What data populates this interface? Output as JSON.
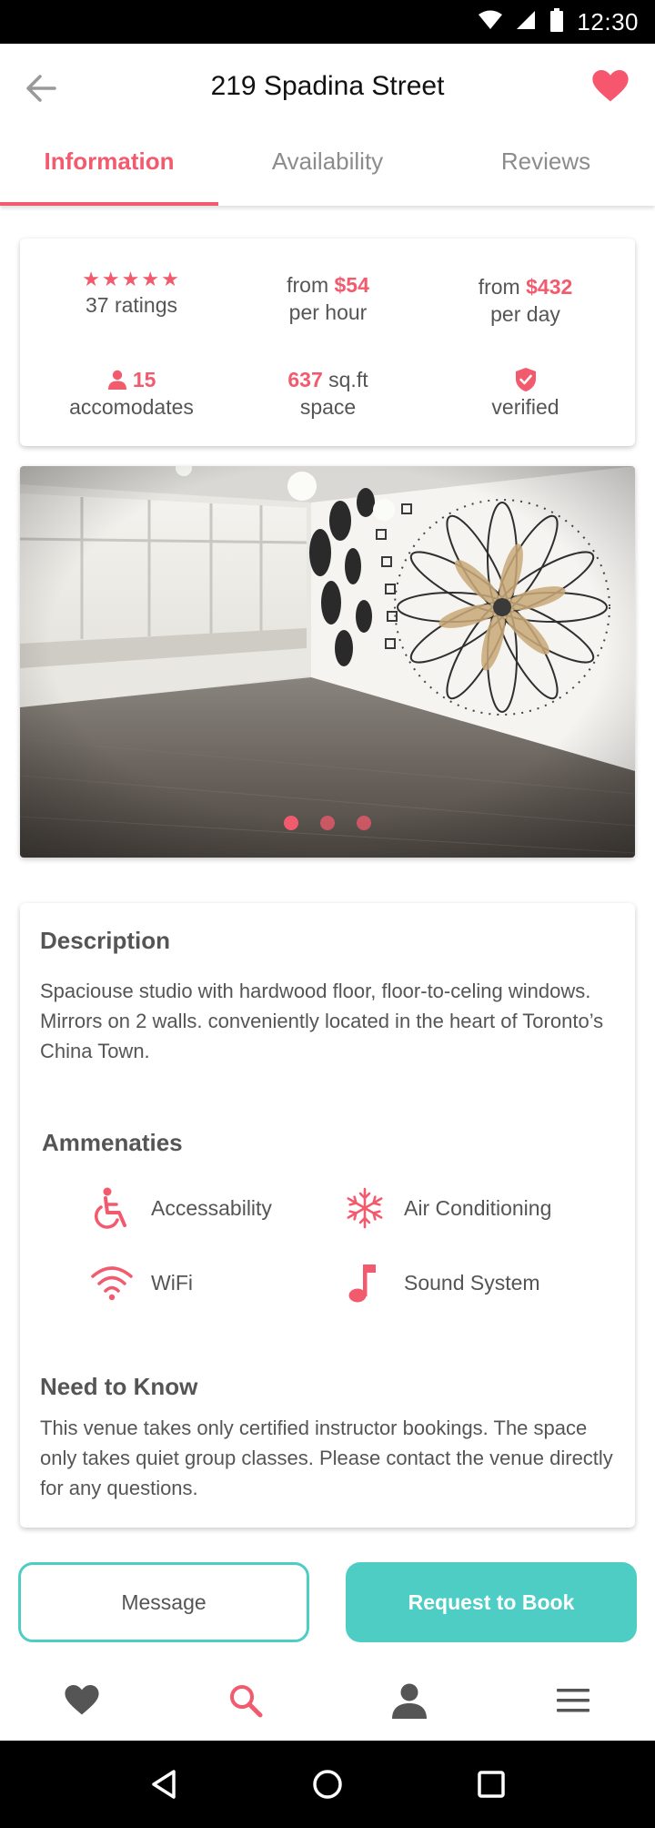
{
  "status_bar": {
    "time": "12:30"
  },
  "header": {
    "title": "219 Spadina Street"
  },
  "tabs": [
    {
      "label": "Information",
      "active": true
    },
    {
      "label": "Availability",
      "active": false
    },
    {
      "label": "Reviews",
      "active": false
    }
  ],
  "stats": {
    "rating_stars": "★★★★★",
    "ratings": "37 ratings",
    "hourly_prefix": "from",
    "hourly_price": "$54",
    "hourly_unit": "per hour",
    "daily_prefix": "from",
    "daily_price": "$432",
    "daily_unit": "per day",
    "capacity": "15",
    "capacity_label": "accomodates",
    "area_value": "637",
    "area_unit": "sq.ft",
    "area_label": "space",
    "verified_label": "verified"
  },
  "carousel": {
    "slides": 3,
    "active_index": 0
  },
  "description": {
    "title": "Description",
    "text": "Spaciouse studio with hardwood floor, floor-to-celing windows. Mirrors on 2 walls. conveniently located in the heart of Toronto’s China Town."
  },
  "amenities": {
    "title": "Ammenaties",
    "items": [
      {
        "label": "Accessability",
        "icon": "wheelchair-icon"
      },
      {
        "label": "Air Conditioning",
        "icon": "snowflake-icon"
      },
      {
        "label": "WiFi",
        "icon": "wifi-icon"
      },
      {
        "label": "Sound System",
        "icon": "music-note-icon"
      }
    ]
  },
  "need_to_know": {
    "title": "Need to Know",
    "text": "This venue takes only certified instructor bookings. The space only takes quiet group classes. Please contact the venue directly for any questions."
  },
  "actions": {
    "message_label": "Message",
    "book_label": "Request to Book"
  },
  "bottom_nav": [
    "heart-icon",
    "search-icon",
    "person-icon",
    "menu-icon"
  ],
  "colors": {
    "accent": "#f25a6e",
    "teal": "#4ecdc4",
    "text": "#555555"
  }
}
